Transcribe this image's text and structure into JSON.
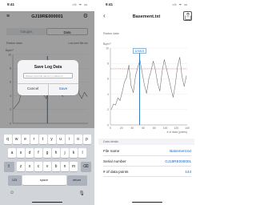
{
  "left": {
    "status": {
      "time": "9:41",
      "icons": "ıll ᯤ ▭"
    },
    "header": {
      "title": "GJ19RE000001"
    },
    "tabs": [
      {
        "label": "Gauges"
      },
      {
        "label": "Data"
      }
    ],
    "chart_section": {
      "label": "Radon data",
      "info": "Low-level Bin:xxx"
    },
    "dialog": {
      "title": "Save Log Data",
      "placeholder": "Please input file name (x.y.data.txt)",
      "cancel_label": "Cancel",
      "save_label": "Save"
    },
    "keyboard": {
      "row1": [
        "q",
        "w",
        "e",
        "r",
        "t",
        "y",
        "u",
        "i",
        "o",
        "p"
      ],
      "row2": [
        "a",
        "s",
        "d",
        "f",
        "g",
        "h",
        "j",
        "k",
        "l"
      ],
      "row3": [
        "z",
        "x",
        "c",
        "v",
        "b",
        "n",
        "m"
      ],
      "shift": "⇧",
      "backspace": "⌫",
      "numbers": "123",
      "space": "space",
      "return": "return",
      "emoji": "☺",
      "mic": "🎙"
    }
  },
  "right": {
    "status": {
      "time": "9:41",
      "icons": "ıll ᯤ ▭"
    },
    "header": {
      "title": "Basement.txt"
    },
    "chart_section": {
      "label": "Radon data"
    },
    "data_section": {
      "label": "Data details"
    },
    "details": [
      {
        "key": "File name",
        "value": "Basement.txt"
      },
      {
        "key": "Serial number",
        "value": "GJ19RE000001"
      },
      {
        "key": "# of data points",
        "value": "144"
      }
    ]
  },
  "chart_data": [
    {
      "type": "line",
      "title": "",
      "ylabel": "Bq/m³",
      "xlabel": "",
      "yticks": [
        "10",
        "8",
        "6",
        "4",
        "2",
        "0"
      ],
      "ylim": [
        0,
        10
      ],
      "series": [
        {
          "values": [
            2.1,
            2.6,
            3.1,
            4.8,
            5.2,
            7.6,
            6.3,
            5.4,
            4.3,
            6.2,
            5.1,
            4.2,
            3.6,
            5.8,
            4.8,
            6.1,
            5.3,
            4.6,
            3.9,
            5.4,
            4.9,
            4.1,
            5.6,
            6.8,
            4.3,
            3.6,
            4.5,
            3.9
          ]
        }
      ],
      "accent": "#1f6fb5"
    },
    {
      "type": "line",
      "title": "",
      "ylabel": "Bq/m³",
      "xlabel": "# of data (points)",
      "yticks": [
        "10",
        "8",
        "6",
        "4",
        "2",
        "0"
      ],
      "xticks": [
        "0",
        "20",
        "40",
        "60",
        "80",
        "100",
        "120",
        "140"
      ],
      "ylim": [
        0,
        10
      ],
      "marker_label": "12/18/21",
      "threshold": 7.3,
      "series": [
        {
          "values": [
            2.0,
            2.7,
            2.6,
            3.5,
            3.2,
            4.3,
            5.6,
            6.2,
            7.8,
            5.1,
            4.2,
            6.4,
            7.5,
            8.4,
            6.8,
            5.2,
            4.1,
            6.0,
            7.0,
            8.3,
            7.1,
            5.4,
            4.4,
            6.9,
            8.5,
            7.3,
            6.1,
            4.8,
            3.6,
            5.3,
            7.6,
            8.8,
            6.3,
            5.0,
            6.4
          ]
        }
      ],
      "accent": "#1f6fb5",
      "threshold_color": "#e06b6b"
    }
  ]
}
